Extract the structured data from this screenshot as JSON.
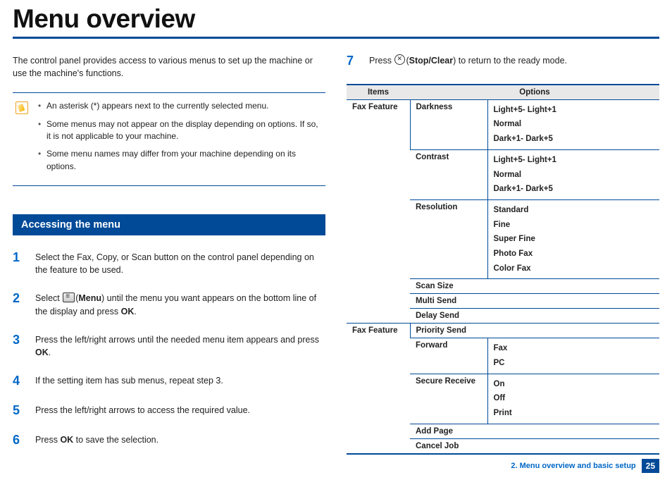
{
  "title": "Menu overview",
  "intro": "The control panel provides access to various menus to set up the machine or use the machine's functions.",
  "notes": [
    "An asterisk (*) appears next to the currently selected menu.",
    "Some menus may not appear on the display depending on options. If so, it is not applicable to your machine.",
    "Some menu names may differ from your machine depending on its options."
  ],
  "section_heading": "Accessing the menu",
  "steps": {
    "s1": "Select the Fax, Copy, or Scan button on the control panel depending on the feature to be used.",
    "s2a": "Select ",
    "s2b": "(",
    "s2c": "Menu",
    "s2d": ") until the menu you want appears on the bottom line of the display and press ",
    "s2e": "OK",
    "s2f": ".",
    "s3a": "Press the left/right arrows until the needed menu item appears and press ",
    "s3b": "OK",
    "s3c": ".",
    "s4": "If the setting item has sub menus, repeat step 3.",
    "s5": "Press the left/right arrows to access the required value.",
    "s6a": "Press ",
    "s6b": "OK",
    "s6c": " to save the selection.",
    "s7a": "Press ",
    "s7b": "(",
    "s7c": "Stop/Clear",
    "s7d": ") to return to the ready mode."
  },
  "table": {
    "head_items": "Items",
    "head_options": "Options",
    "group1_label": "Fax Feature",
    "darkness_label": "Darkness",
    "darkness_v1": "Light+5- Light+1",
    "darkness_v2": " Normal",
    "darkness_v3": "Dark+1- Dark+5",
    "contrast_label": "Contrast",
    "contrast_v1": "Light+5- Light+1",
    "contrast_v2": " Normal",
    "contrast_v3": "Dark+1- Dark+5",
    "resolution_label": "Resolution",
    "resolution_v1": "Standard",
    "resolution_v2": "Fine",
    "resolution_v3": "Super Fine",
    "resolution_v4": "Photo Fax",
    "resolution_v5": "Color Fax",
    "scansize_label": "Scan Size",
    "multisend_label": "Multi Send",
    "delaysend_label": "Delay Send",
    "group2_label": "Fax Feature",
    "priority_label": "Priority Send",
    "forward_label": "Forward",
    "forward_v1": "Fax",
    "forward_v2": "PC",
    "secure_label": "Secure Receive",
    "secure_v1": "On",
    "secure_v2": "Off",
    "secure_v3": "Print",
    "addpage_label": "Add Page",
    "canceljob_label": "Cancel Job"
  },
  "footer_chapter": "2. Menu overview and basic setup",
  "footer_page": "25"
}
